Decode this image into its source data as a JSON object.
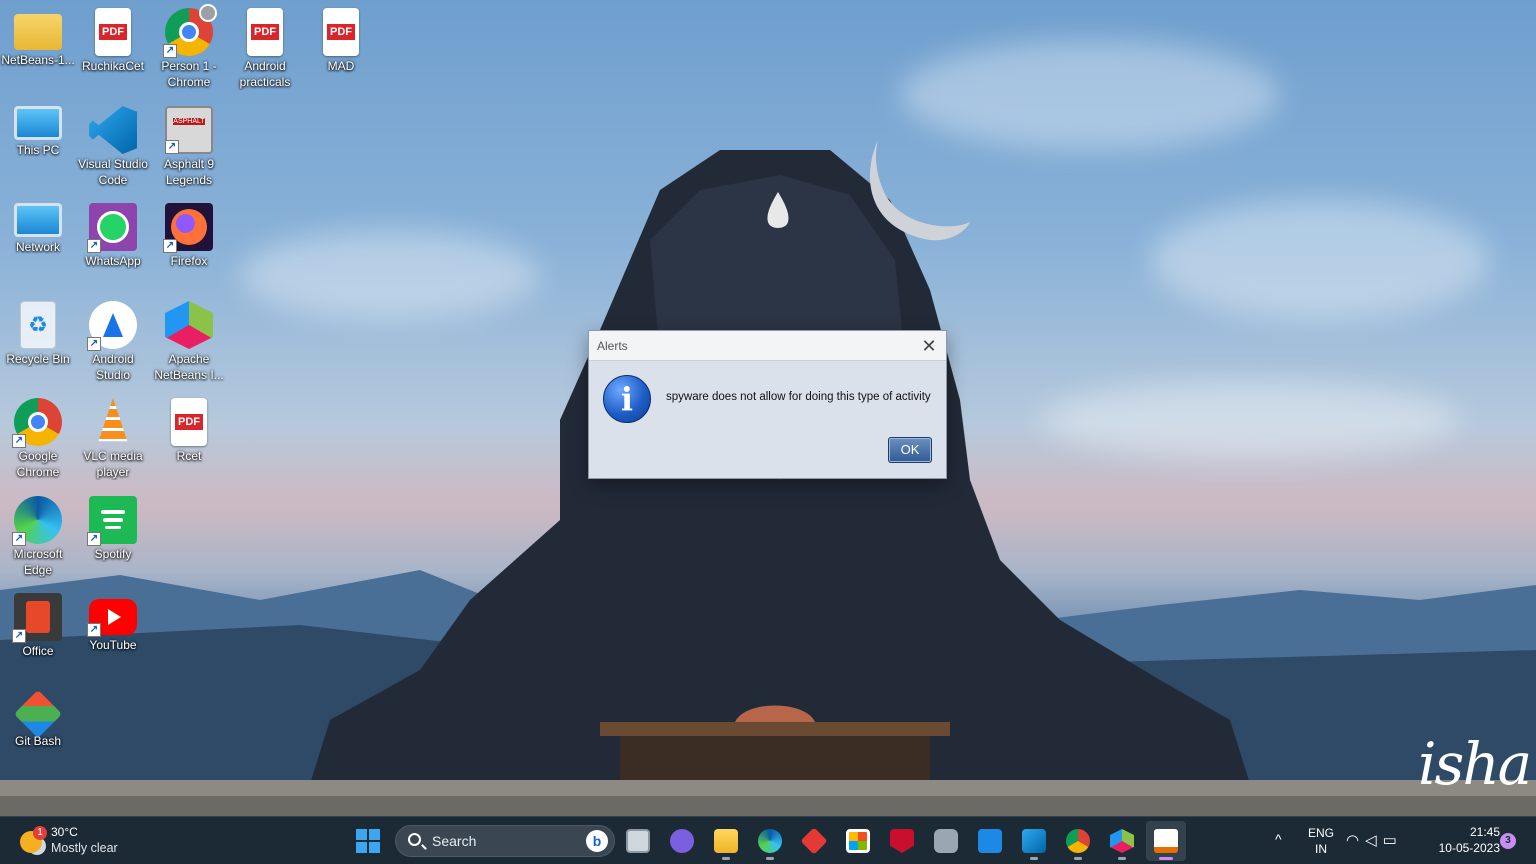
{
  "desktop": {
    "icons": [
      {
        "label": "NetBeans-1...",
        "icon": "folder-icon"
      },
      {
        "label": "RuchikaCet",
        "icon": "pdf-file-icon"
      },
      {
        "label": "Person 1 -\nChrome",
        "icon": "chrome-profile-icon"
      },
      {
        "label": "Android\npracticals",
        "icon": "pdf-file-icon"
      },
      {
        "label": "MAD",
        "icon": "pdf-file-icon"
      },
      {
        "label": "This PC",
        "icon": "monitor-icon"
      },
      {
        "label": "Visual Studio\nCode",
        "icon": "vscode-icon"
      },
      {
        "label": "Asphalt 9\nLegends",
        "icon": "asphalt-game-icon"
      },
      {
        "label": "Network",
        "icon": "network-icon"
      },
      {
        "label": "WhatsApp",
        "icon": "whatsapp-icon"
      },
      {
        "label": "Firefox",
        "icon": "firefox-icon"
      },
      {
        "label": "Recycle Bin",
        "icon": "recycle-bin-icon"
      },
      {
        "label": "Android\nStudio",
        "icon": "android-studio-icon"
      },
      {
        "label": "Apache\nNetBeans I...",
        "icon": "netbeans-icon"
      },
      {
        "label": "Google\nChrome",
        "icon": "chrome-icon"
      },
      {
        "label": "VLC media\nplayer",
        "icon": "vlc-icon"
      },
      {
        "label": "Rcet",
        "icon": "pdf-file-icon"
      },
      {
        "label": "Microsoft\nEdge",
        "icon": "edge-icon"
      },
      {
        "label": "Spotify",
        "icon": "spotify-icon"
      },
      {
        "label": "Office",
        "icon": "office-icon"
      },
      {
        "label": "YouTube",
        "icon": "youtube-icon"
      },
      {
        "label": "Git Bash",
        "icon": "git-bash-icon"
      }
    ],
    "pdf_badge": "PDF",
    "asphalt_badge": "ASPHALT",
    "watermark": "isha"
  },
  "dialog": {
    "title": "Alerts",
    "message": "spyware does not allow for doing this type of activity",
    "ok_label": "OK",
    "close_glyph": "✕",
    "info_glyph": "i"
  },
  "taskbar": {
    "weather": {
      "temp": "30°C",
      "condition": "Mostly clear",
      "badge": "1"
    },
    "search_placeholder": "Search",
    "bing_glyph": "b",
    "apps": [
      "windows-start-icon",
      "task-view-icon",
      "teams-chat-icon",
      "file-explorer-icon",
      "edge-icon",
      "app-red-icon",
      "microsoft-store-icon",
      "mcafee-icon",
      "camera-icon",
      "windows-app-icon",
      "vscode-icon",
      "chrome-icon",
      "netbeans-icon",
      "java-icon"
    ],
    "tray": {
      "chevron": "^",
      "lang_line1": "ENG",
      "lang_line2": "IN",
      "time": "21:45",
      "date": "10-05-2023",
      "notifications": "3"
    }
  },
  "colors": {
    "taskbar_bg": "#1c2a36",
    "dialog_bg": "#dbe1ea",
    "ok_button": "#2f5b93",
    "active_indicator": "#c58ef0"
  }
}
